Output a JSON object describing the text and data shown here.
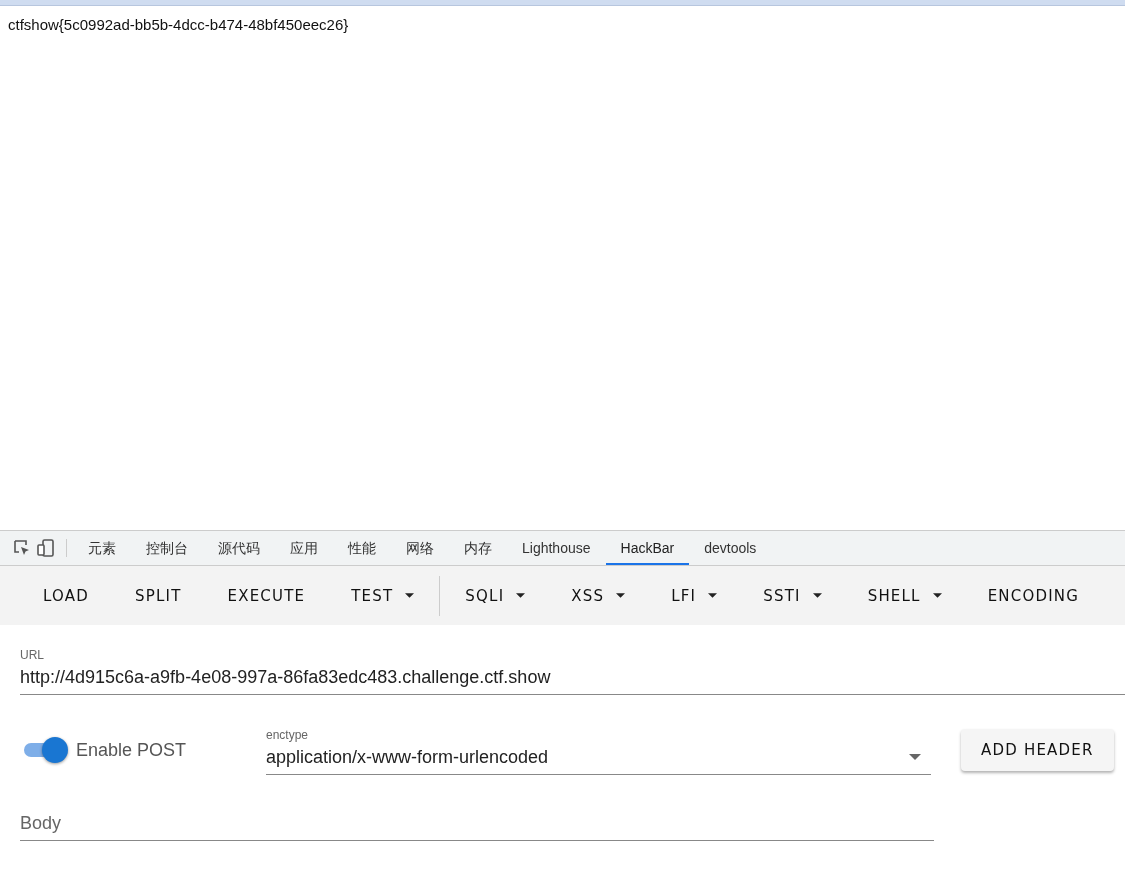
{
  "page": {
    "text": "ctfshow{5c0992ad-bb5b-4dcc-b474-48bf450eec26}"
  },
  "devtools_tabs": [
    {
      "label": "元素",
      "selected": false
    },
    {
      "label": "控制台",
      "selected": false
    },
    {
      "label": "源代码",
      "selected": false
    },
    {
      "label": "应用",
      "selected": false
    },
    {
      "label": "性能",
      "selected": false
    },
    {
      "label": "网络",
      "selected": false
    },
    {
      "label": "内存",
      "selected": false
    },
    {
      "label": "Lighthouse",
      "selected": false
    },
    {
      "label": "HackBar",
      "selected": true
    },
    {
      "label": "devtools",
      "selected": false
    }
  ],
  "toolbar": [
    {
      "label": "LOAD",
      "kind": "plain"
    },
    {
      "label": "SPLIT",
      "kind": "plain"
    },
    {
      "label": "EXECUTE",
      "kind": "plain"
    },
    {
      "label": "TEST",
      "kind": "menu"
    },
    {
      "kind": "divider"
    },
    {
      "label": "SQLI",
      "kind": "menu"
    },
    {
      "label": "XSS",
      "kind": "menu"
    },
    {
      "label": "LFI",
      "kind": "menu"
    },
    {
      "label": "SSTI",
      "kind": "menu"
    },
    {
      "label": "SHELL",
      "kind": "menu"
    },
    {
      "label": "ENCODING",
      "kind": "plain"
    }
  ],
  "url": {
    "label": "URL",
    "value": "http://4d915c6a-a9fb-4e08-997a-86fa83edc483.challenge.ctf.show"
  },
  "post_toggle": {
    "label": "Enable POST",
    "on": true
  },
  "enctype": {
    "label": "enctype",
    "value": "application/x-www-form-urlencoded"
  },
  "add_header": {
    "label": "ADD HEADER"
  },
  "body": {
    "placeholder": "Body"
  }
}
